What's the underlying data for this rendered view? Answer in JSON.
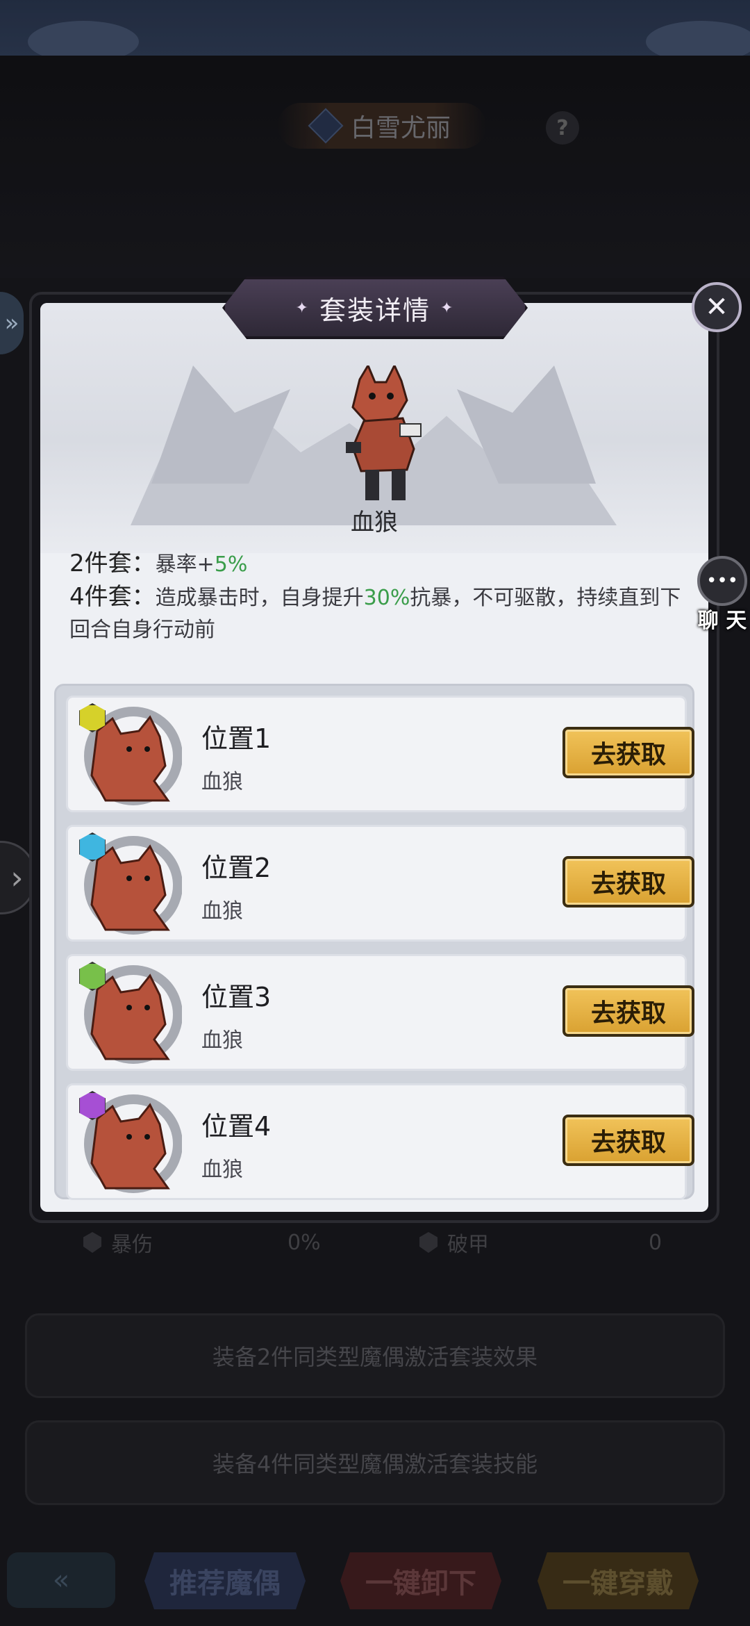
{
  "background": {
    "character_name": "白雪尤丽",
    "help_symbol": "?",
    "stats": [
      {
        "label": "暴伤",
        "value": "0%"
      },
      {
        "label": "破甲",
        "value": "0"
      }
    ],
    "banner_2": "装备2件同类型魔偶激活套装效果",
    "banner_4": "装备4件同类型魔偶激活套装技能",
    "buttons": {
      "recommend": "推荐魔偶",
      "unequip_all": "一键卸下",
      "equip_all": "一键穿戴"
    }
  },
  "modal": {
    "title": "套装详情",
    "close_symbol": "✕",
    "set_name": "血狼",
    "bonuses": [
      {
        "label": "2件套：",
        "text_before": "暴率+",
        "highlight": "5%",
        "text_after": ""
      },
      {
        "label": "4件套：",
        "text_before": "造成暴击时，自身提升",
        "highlight": "30%",
        "text_after": "抗暴，不可驱散，持续直到下回合自身行动前"
      }
    ],
    "slots": [
      {
        "title": "位置1",
        "subtitle": "血狼",
        "button": "去获取",
        "gem_color": "#d6d12a"
      },
      {
        "title": "位置2",
        "subtitle": "血狼",
        "button": "去获取",
        "gem_color": "#3fb6e0"
      },
      {
        "title": "位置3",
        "subtitle": "血狼",
        "button": "去获取",
        "gem_color": "#78c04a"
      },
      {
        "title": "位置4",
        "subtitle": "血狼",
        "button": "去获取",
        "gem_color": "#a64fd4"
      }
    ]
  },
  "chat": {
    "label": "聊 天"
  },
  "colors": {
    "accent_green": "#3a9d4a",
    "gold_button": "#e3ad41",
    "wolf": "#b6523b"
  }
}
